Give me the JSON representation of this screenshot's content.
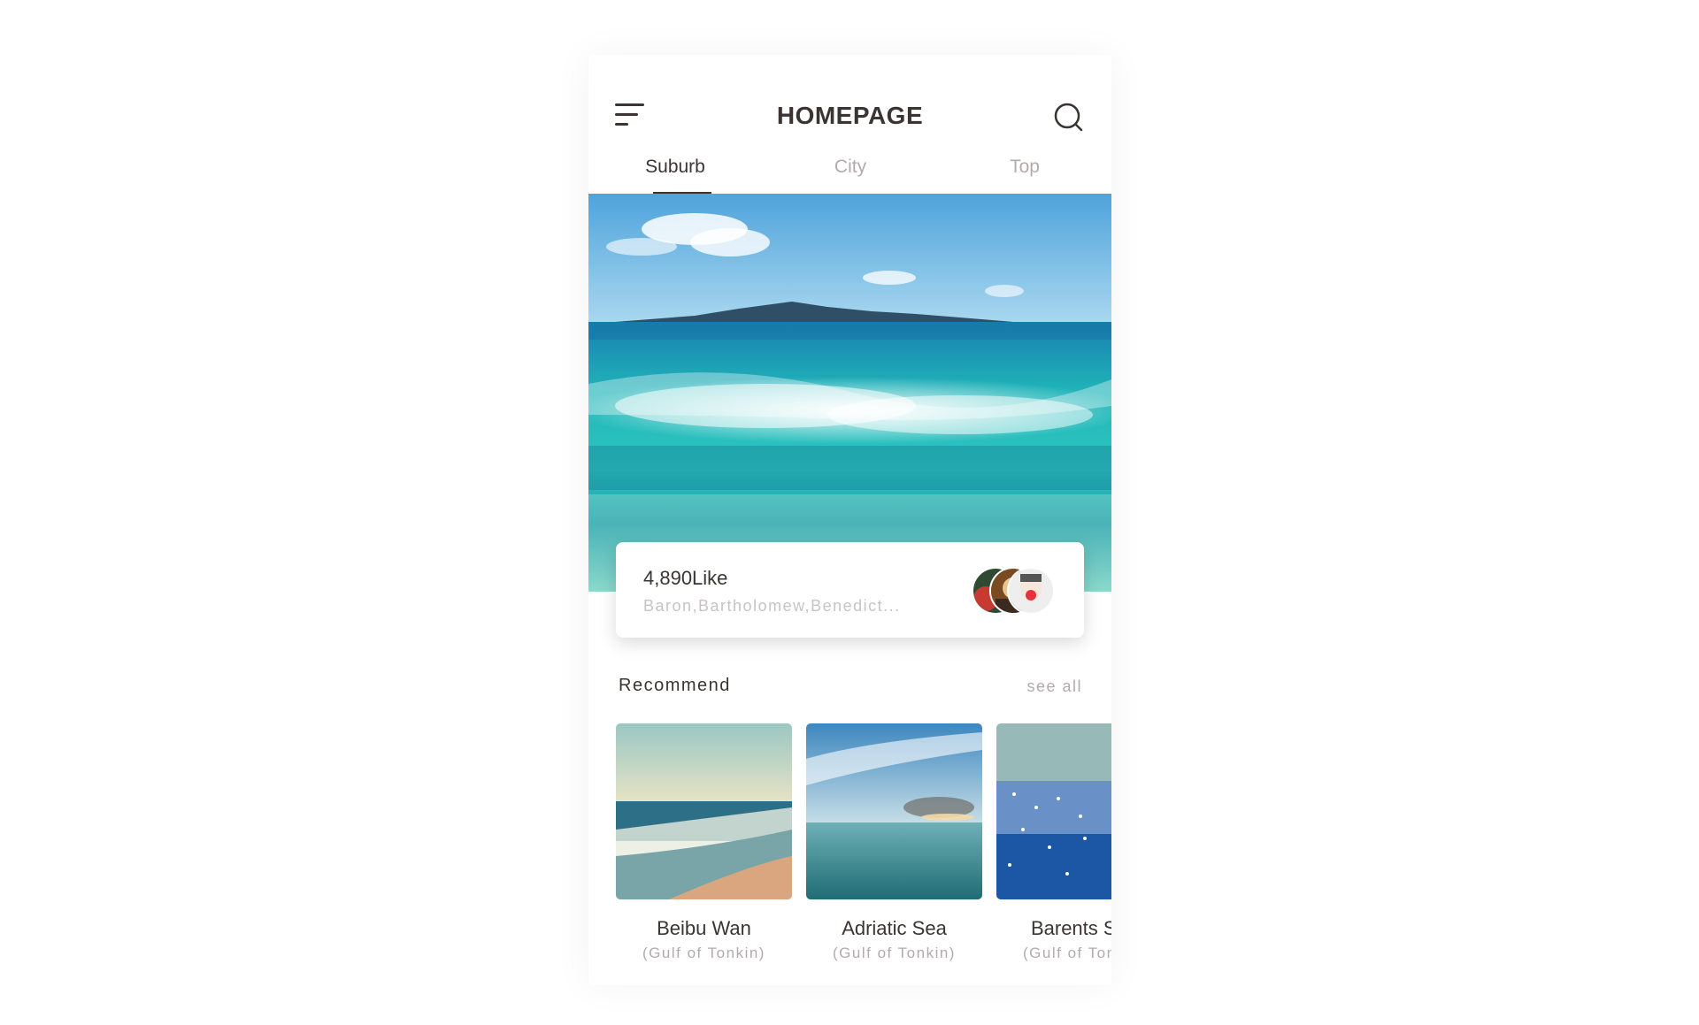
{
  "header": {
    "title": "HOMEPAGE",
    "menu_icon": "menu-icon",
    "search_icon": "search-icon"
  },
  "tabs": [
    {
      "label": "Suburb",
      "active": true
    },
    {
      "label": "City",
      "active": false
    },
    {
      "label": "Top",
      "active": false
    }
  ],
  "hero": {
    "image": "ocean-wave-photo"
  },
  "like_card": {
    "count": "4,890Like",
    "names": "Baron,Bartholomew,Benedict..."
  },
  "recommend": {
    "title": "Recommend",
    "see_all": "see all",
    "items": [
      {
        "name": "Beibu Wan",
        "subtitle": "(Gulf of Tonkin)"
      },
      {
        "name": "Adriatic Sea",
        "subtitle": "(Gulf of Tonkin)"
      },
      {
        "name": "Barents Sea",
        "subtitle": "(Gulf of Tonkin)"
      }
    ]
  },
  "colors": {
    "text_primary": "#3a3432",
    "text_muted": "#b3abab",
    "text_faint": "#c9c3c3",
    "background": "#ffffff"
  }
}
